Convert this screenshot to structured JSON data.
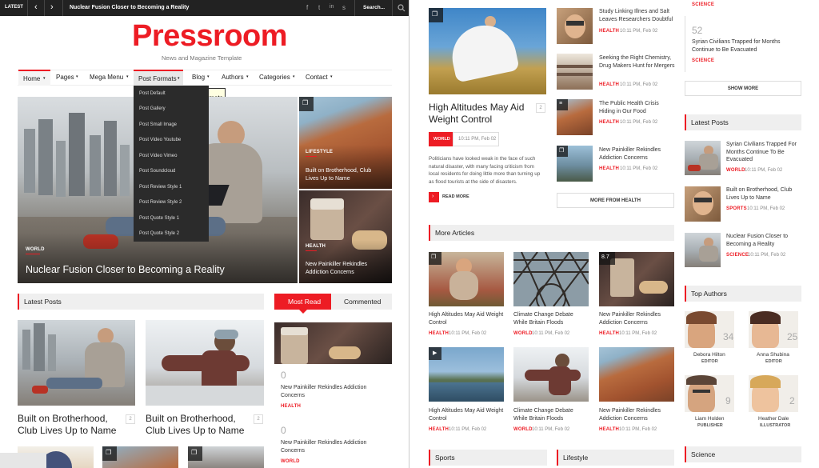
{
  "topbar": {
    "latest_label": "LATEST",
    "prev": "‹",
    "next": "›",
    "ticker": "Nuclear Fusion Closer to Becoming a Reality",
    "search_placeholder": "Search...",
    "social": [
      "f",
      "t",
      "in",
      "s"
    ]
  },
  "logo": {
    "title": "Pressroom",
    "tagline": "News and Magazine Template"
  },
  "nav": {
    "items": [
      "Home",
      "Pages",
      "Mega Menu",
      "Post Formats",
      "Blog",
      "Authors",
      "Categories",
      "Contact"
    ],
    "tooltip": "Post Formats",
    "dropdown": [
      "Post Default",
      "Post Gallery",
      "Post Small Image",
      "Post Video Youtube",
      "Post Video Vimeo",
      "Post Soundcloud",
      "Post Review Style 1",
      "Post Review Style 2",
      "Post Quote Style 1",
      "Post Quote Style 2"
    ]
  },
  "hero": {
    "main": {
      "category": "WORLD",
      "title": "Nuclear Fusion Closer to Becoming a Reality"
    },
    "side1": {
      "category": "LIFESTYLE",
      "title": "Built on Brotherhood, Club Lives Up to Name"
    },
    "side2": {
      "category": "HEALTH",
      "title": "New Painkiller Rekindles Addiction Concerns"
    }
  },
  "latest_posts": {
    "heading": "Latest Posts",
    "items": [
      {
        "title": "Built on Brotherhood, Club Lives Up to Name",
        "count": "2"
      },
      {
        "title": "Built on Brotherhood, Club Lives Up to Name",
        "count": "2"
      }
    ]
  },
  "tabs": {
    "most_read": "Most Read",
    "commented": "Commented"
  },
  "most_read": [
    {
      "num": "0",
      "title": "New Painkiller Rekindles Addiction Concerns",
      "cat": "HEALTH"
    },
    {
      "num": "0",
      "title": "New Painkiller Rekindles Addiction Concerns",
      "cat": "WORLD"
    }
  ],
  "feature": {
    "title": "High Altitudes May Aid Weight Control",
    "count": "2",
    "cat": "WORLD",
    "date": "10:11 PM, Feb 02",
    "excerpt": "Politicians have looked weak in the face of such natural disaster, with many facing criticism from local residents for doing little more than turning up as flood tourists at the side of disasters.",
    "read_more": "READ MORE"
  },
  "health_list": [
    {
      "title": "Study Linking Illnes and Salt Leaves Researchers Doubtful",
      "cat": "HEALTH",
      "date": "10:11 PM, Feb 02"
    },
    {
      "title": "Seeking the Right Chemistry, Drug Makers Hunt for Mergers",
      "cat": "HEALTH",
      "date": "10:11 PM, Feb 02"
    },
    {
      "title": "The Public Health Crisis Hiding in Our Food",
      "cat": "HEALTH",
      "date": "10:11 PM, Feb 02"
    },
    {
      "title": "New Painkiller Rekindles Addiction Concerns",
      "cat": "HEALTH",
      "date": "10:11 PM, Feb 02"
    }
  ],
  "more_from_health": "MORE FROM HEALTH",
  "more_articles": {
    "heading": "More Articles",
    "items": [
      {
        "title": "High Altitudes May Aid Weight Control",
        "cat": "HEALTH",
        "date": "10:11 PM, Feb 02"
      },
      {
        "title": "Climate Change Debate While Britain Floods",
        "cat": "WORLD",
        "date": "10:11 PM, Feb 02"
      },
      {
        "title": "New Painkiller Rekindles Addiction Concerns",
        "cat": "HEALTH",
        "date": "10:11 PM, Feb 02",
        "rating": "8.7"
      },
      {
        "title": "High Altitudes May Aid Weight Control",
        "cat": "HEALTH",
        "date": "10:11 PM, Feb 02"
      },
      {
        "title": "Climate Change Debate While Britain Floods",
        "cat": "WORLD",
        "date": "10:11 PM, Feb 02"
      },
      {
        "title": "New Painkiller Rekindles Addiction Concerns",
        "cat": "HEALTH",
        "date": "10:11 PM, Feb 02"
      }
    ]
  },
  "bottom_sections": {
    "sports": "Sports",
    "lifestyle": "Lifestyle",
    "science": "Science"
  },
  "sidebar": {
    "top_cat": "SCIENCE",
    "top_num": "52",
    "top_title": "Syrian Civilians Trapped for Months Continue to Be Evacuated",
    "top_cat2": "SCIENCE",
    "show_more": "SHOW MORE",
    "latest_heading": "Latest Posts",
    "latest": [
      {
        "title": "Syrian Civilians Trapped For Months Continue To Be Evacuated",
        "cat": "WORLD",
        "date": "10:11 PM, Feb 02"
      },
      {
        "title": "Built on Brotherhood, Club Lives Up to Name",
        "cat": "SPORTS",
        "date": "10:11 PM, Feb 02"
      },
      {
        "title": "Nuclear Fusion Closer to Becoming a Reality",
        "cat": "SCIENCE",
        "date": "10:11 PM, Feb 02"
      }
    ],
    "authors_heading": "Top Authors",
    "authors": [
      {
        "name": "Debora Hilton",
        "role": "EDITOR",
        "count": "34"
      },
      {
        "name": "Anna Shubina",
        "role": "EDITOR",
        "count": "25"
      },
      {
        "name": "Liam Holden",
        "role": "PUBLISHER",
        "count": "9"
      },
      {
        "name": "Heather Dale",
        "role": "ILLUSTRATOR",
        "count": "2"
      }
    ]
  }
}
